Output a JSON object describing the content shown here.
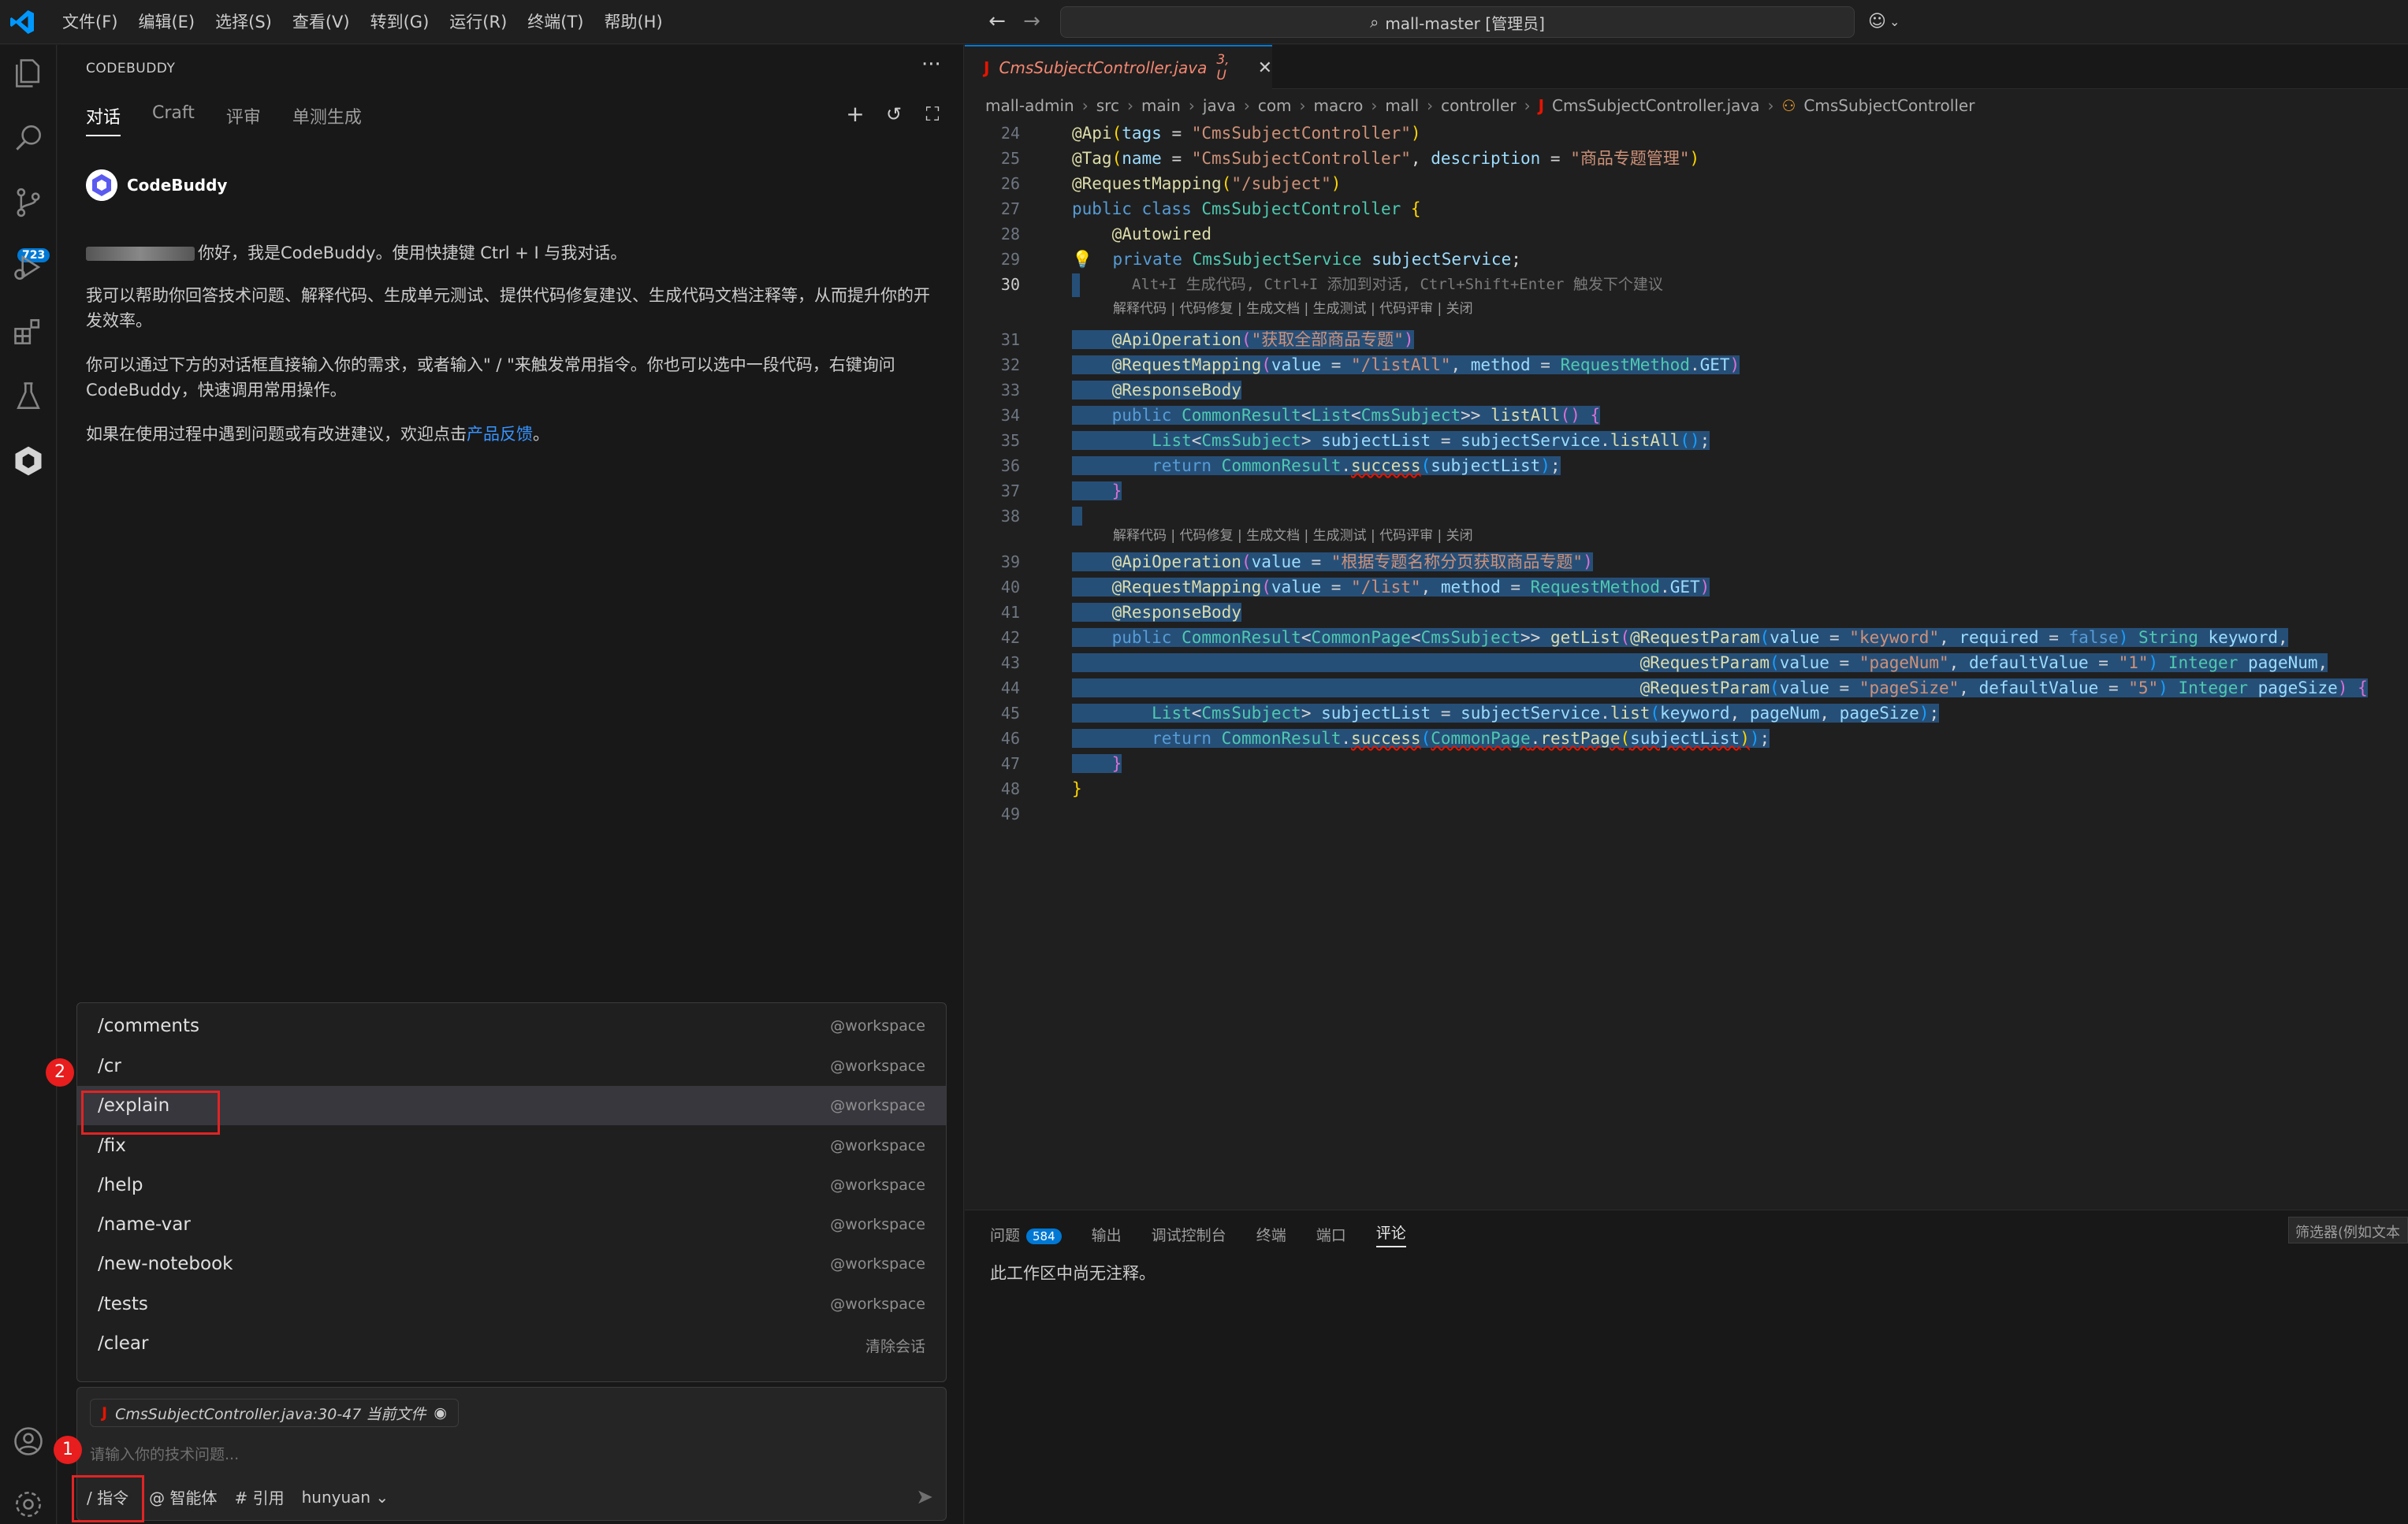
{
  "menu": [
    "文件(F)",
    "编辑(E)",
    "选择(S)",
    "查看(V)",
    "转到(G)",
    "运行(R)",
    "终端(T)",
    "帮助(H)"
  ],
  "command_center": {
    "label": "mall-master [管理员]"
  },
  "activity": {
    "scm_badge": "723"
  },
  "sidebar": {
    "title": "CODEBUDDY",
    "tabs": [
      "对话",
      "Craft",
      "评审",
      "单测生成"
    ],
    "assistant_name": "CodeBuddy",
    "greeting": "你好，我是CodeBuddy。使用快捷键 Ctrl + I 与我对话。",
    "intro": "我可以帮助你回答技术问题、解释代码、生成单元测试、提供代码修复建议、生成代码文档注释等，从而提升你的开发效率。",
    "usage": "你可以通过下方的对话框直接输入你的需求，或者输入\" / \"来触发常用指令。你也可以选中一段代码，右键询问CodeBuddy，快速调用常用操作。",
    "feedback_prefix": "如果在使用过程中遇到问题或有改进建议，欢迎点击",
    "feedback_link": "产品反馈",
    "feedback_suffix": "。"
  },
  "commands": [
    {
      "name": "/comments",
      "scope": "@workspace"
    },
    {
      "name": "/cr",
      "scope": "@workspace"
    },
    {
      "name": "/explain",
      "scope": "@workspace"
    },
    {
      "name": "/fix",
      "scope": "@workspace"
    },
    {
      "name": "/help",
      "scope": "@workspace"
    },
    {
      "name": "/name-var",
      "scope": "@workspace"
    },
    {
      "name": "/new-notebook",
      "scope": "@workspace"
    },
    {
      "name": "/tests",
      "scope": "@workspace"
    },
    {
      "name": "/clear",
      "scope": "清除会话"
    }
  ],
  "annotations": {
    "step1": "1",
    "step2": "2",
    "accent": "#e02424"
  },
  "input": {
    "context_chip": "CmsSubjectController.java:30-47  当前文件",
    "placeholder": "请输入你的技术问题...",
    "toolbar": [
      "/ 指令",
      "@ 智能体",
      "# 引用",
      "hunyuan"
    ]
  },
  "editor": {
    "tab": {
      "name": "CmsSubjectController.java",
      "status": "3, U"
    },
    "breadcrumb": [
      "mall-admin",
      "src",
      "main",
      "java",
      "com",
      "macro",
      "mall",
      "controller",
      "CmsSubjectController.java",
      "CmsSubjectController"
    ],
    "inline_hint": "Alt+I 生成代码, Ctrl+I 添加到对话, Ctrl+Shift+Enter 触发下个建议",
    "codelens": "解释代码 | 代码修复 | 生成文档 | 生成测试 | 代码评审 | 关闭",
    "line_numbers": [
      "24",
      "25",
      "26",
      "27",
      "28",
      "29",
      "30",
      "31",
      "32",
      "33",
      "34",
      "35",
      "36",
      "37",
      "38",
      "39",
      "40",
      "41",
      "42",
      "43",
      "44",
      "45",
      "46",
      "47",
      "48",
      "49"
    ]
  },
  "panel": {
    "tabs": [
      "问题",
      "输出",
      "调试控制台",
      "终端",
      "端口",
      "评论"
    ],
    "problems_count": "584",
    "filter_placeholder": "筛选器(例如文本",
    "message": "此工作区中尚无注释。"
  }
}
